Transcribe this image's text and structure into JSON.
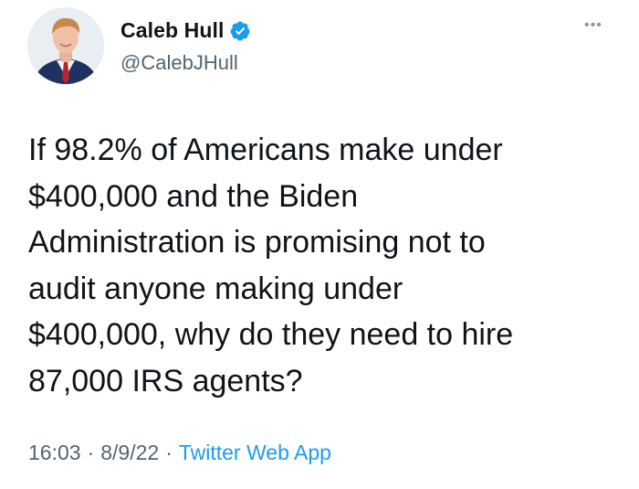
{
  "author": {
    "display_name": "Caleb Hull",
    "handle": "@CalebJHull",
    "verified": true
  },
  "more_icon": "more-horizontal-icon",
  "tweet": {
    "lines": [
      "If 98.2% of Americans make under",
      "$400,000 and the Biden",
      "Administration is promising not to",
      "audit anyone making under",
      "$400,000, why do they need to hire",
      "87,000 IRS agents?"
    ]
  },
  "meta": {
    "time": "16:03",
    "date": "8/9/22",
    "separator": "·",
    "source": "Twitter Web App"
  },
  "colors": {
    "text": "#0f1419",
    "secondary": "#536471",
    "link": "#1d9bf0",
    "verified_badge": "#1d9bf0"
  }
}
